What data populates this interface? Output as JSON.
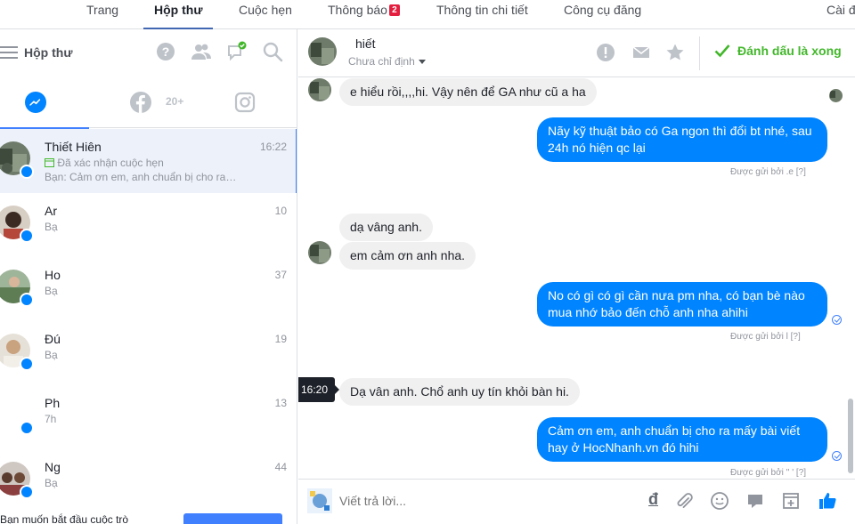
{
  "topnav": {
    "tabs": [
      {
        "label": "Trang"
      },
      {
        "label": "Hộp thư"
      },
      {
        "label": "Cuộc hẹn"
      },
      {
        "label": "Thông báo",
        "badge": "2"
      },
      {
        "label": "Thông tin chi tiết"
      },
      {
        "label": "Công cụ đăng"
      },
      {
        "label": "Cài đ"
      }
    ]
  },
  "sidebar": {
    "title": "Hộp thư",
    "channels": {
      "facebook_count": "20+"
    },
    "conversations": [
      {
        "name": "Thiết Hiên",
        "time": "16:22",
        "status": "Đã xác nhận cuộc hẹn",
        "preview": "Bạn: Cảm ơn em, anh chuẩn bị cho ra…"
      },
      {
        "name": "Ar",
        "time": "10",
        "preview": "Bạ"
      },
      {
        "name": "Ho",
        "time": "37",
        "preview": "Bạ"
      },
      {
        "name": "Đú",
        "time": "19",
        "preview": "Bạ"
      },
      {
        "name": "Ph",
        "time": "13",
        "preview": "7h"
      },
      {
        "name": "Ng",
        "time": "44",
        "preview": "Bạ"
      }
    ],
    "footer_text": "Bạn muốn bắt đầu cuộc trò"
  },
  "thread_header": {
    "name": "hiết",
    "assign_label": "Chưa chỉ định",
    "done_label": "Đánh dấu là xong"
  },
  "messages": {
    "m1": "e hiểu rồi,,,,hi. Vậy nên để GA như cũ a ha",
    "m2_l1": "Nãy kỹ thuật bảo có Ga ngon thì đổi bt nhé, sau",
    "m2_l2": "24h nó hiện qc lại",
    "sent_by_1": "Được gửi bởi       .e  [?]",
    "m3": "dạ vâng anh.",
    "m4": "em cảm ơn anh nha.",
    "m5_l1": "No có gì có gì cần nưa pm nha, có bạn bè nào",
    "m5_l2": "mua nhớ bảo đến chỗ anh nha ahihi",
    "sent_by_2": "Được gửi bởi  l      [?]",
    "time_tip": "16:20",
    "m6": "Dạ vân anh. Chổ anh uy tín khỏi bàn hi.",
    "m7_l1": "Cảm ơn em, anh chuẩn bị cho ra mấy bài viết",
    "m7_l2": "hay ở HocNhanh.vn đó hihi",
    "sent_by_3": "Được gửi bởi  ''   '  [?]"
  },
  "composer": {
    "placeholder": "Viết trả lời...",
    "currency_symbol": "đ"
  },
  "colors": {
    "accent": "#4080ff",
    "outgoing_bubble": "#0084ff",
    "incoming_bubble": "#f1f0f0",
    "done_green": "#42b72a",
    "notification_red": "#e41e3f"
  },
  "icons": [
    "hamburger-icon",
    "help-icon",
    "people-icon",
    "message-check-icon",
    "search-icon",
    "messenger-icon",
    "facebook-icon",
    "instagram-icon",
    "alert-icon",
    "mail-icon",
    "star-icon",
    "check-icon",
    "attach-icon",
    "emoji-icon",
    "sticker-icon",
    "gif-icon",
    "like-icon"
  ]
}
